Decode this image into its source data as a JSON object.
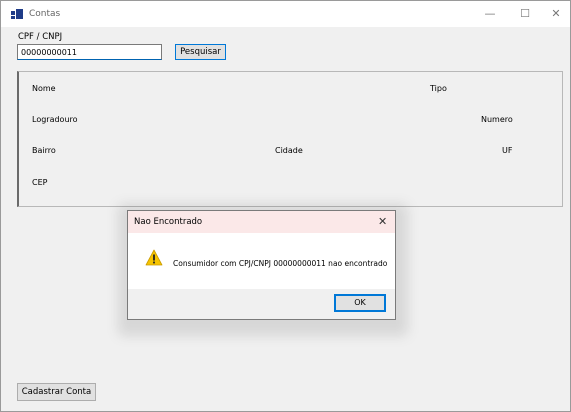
{
  "window": {
    "title": "Contas",
    "icon": "app-form-icon",
    "minimize_glyph": "—",
    "maximize_glyph": "☐",
    "close_glyph": "✕"
  },
  "search": {
    "label": "CPF / CNPJ",
    "value": "00000000011",
    "button_label": "Pesquisar"
  },
  "details": {
    "nome_label": "Nome",
    "tipo_label": "Tipo",
    "logradouro_label": "Logradouro",
    "numero_label": "Numero",
    "bairro_label": "Bairro",
    "cidade_label": "Cidade",
    "uf_label": "UF",
    "cep_label": "CEP"
  },
  "footer": {
    "register_button_label": "Cadastrar Conta"
  },
  "dialog": {
    "title": "Nao Encontrado",
    "close_glyph": "✕",
    "icon": "warning-icon",
    "message": "Consumidor com CPJ/CNPJ 00000000011 nao encontrado",
    "ok_label": "OK"
  },
  "colors": {
    "accent": "#0078d7",
    "warning": "#f6c400",
    "dialog_titlebar": "#fbe8e8"
  }
}
